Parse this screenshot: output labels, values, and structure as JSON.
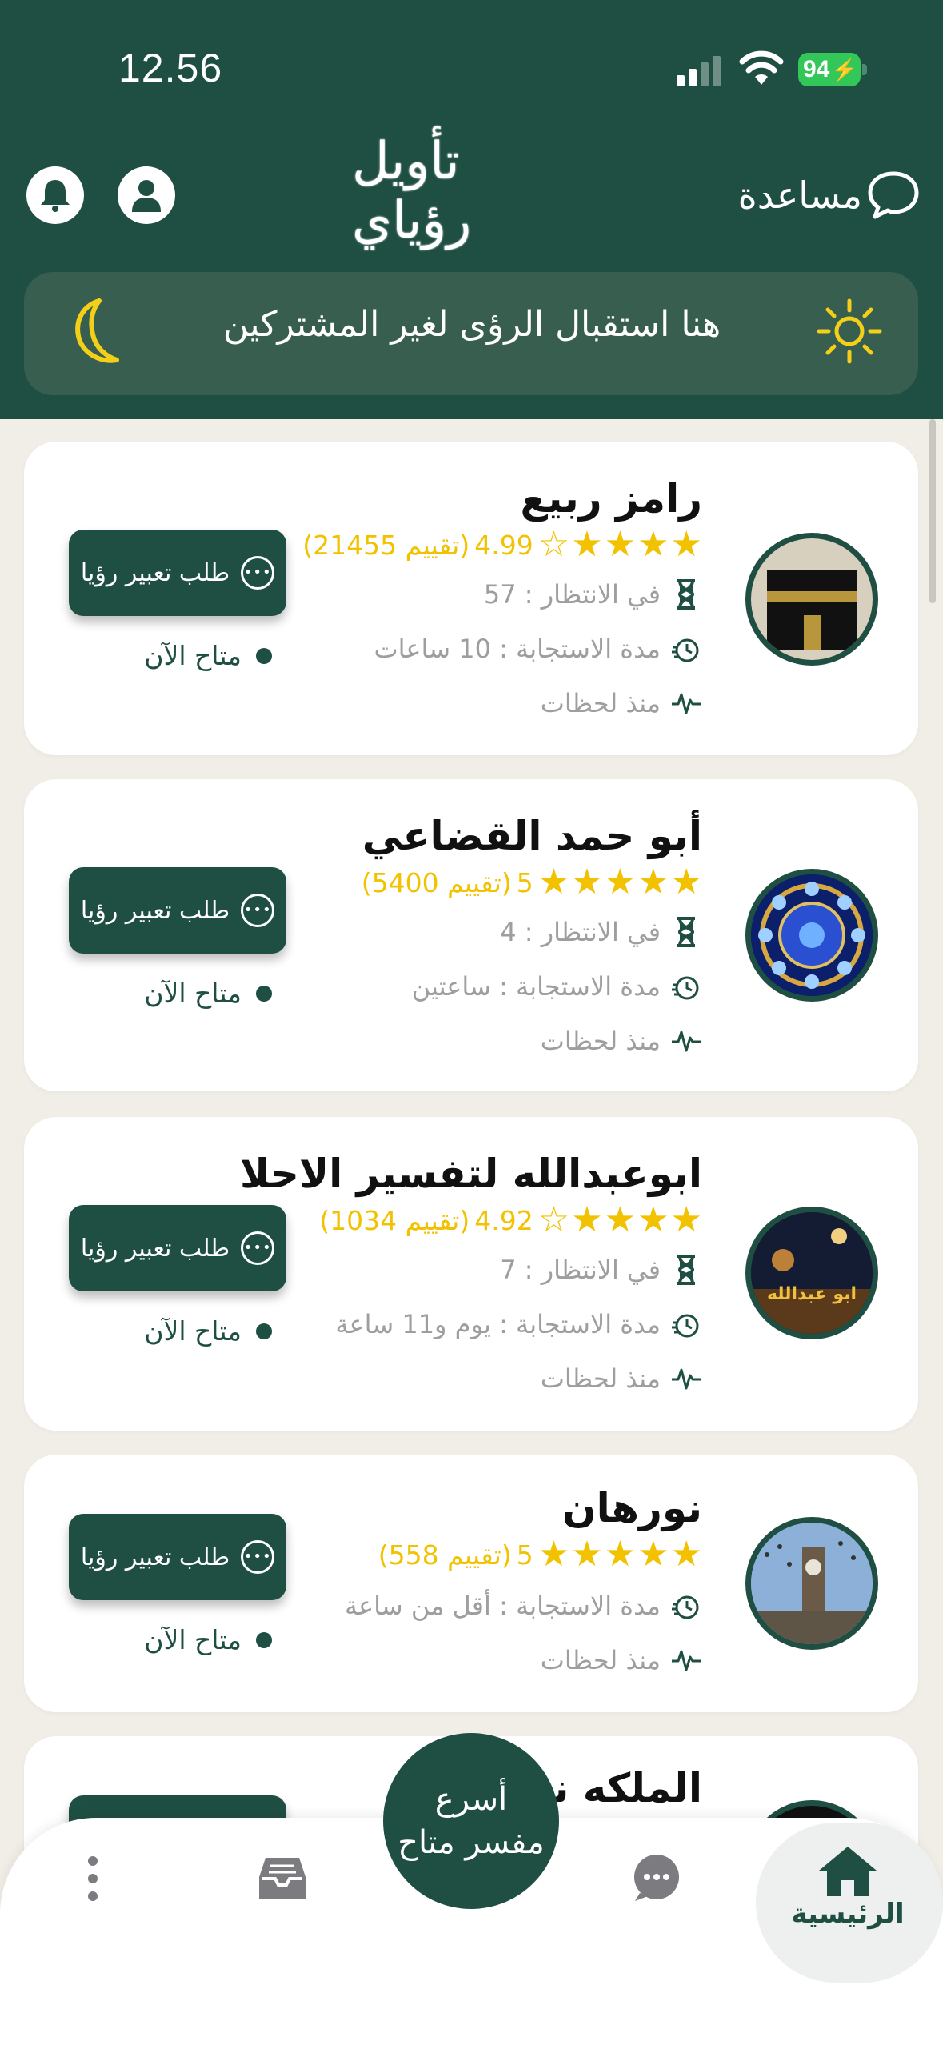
{
  "status": {
    "time": "12.56",
    "battery": "94"
  },
  "header": {
    "logo_text": "تأويل رؤياي",
    "help_label": "مساعدة",
    "banner_text": "هنا استقبال الرؤى لغير المشتركين"
  },
  "cards": [
    {
      "name": "رامز ربيع",
      "rating_value": "4.99",
      "rating_count": "(21455 تقييم)",
      "waiting": "في الانتظار : 57",
      "response": "مدة الاستجابة : 10 ساعات",
      "last_seen": "منذ لحظات",
      "request_label": "طلب تعبير رؤيا",
      "status": "متاح الآن",
      "stars_full": 4,
      "stars_empty": 1
    },
    {
      "name": "أبو حمد القضاعي",
      "rating_value": "5",
      "rating_count": "(5400 تقييم)",
      "waiting": "في الانتظار : 4",
      "response": "مدة الاستجابة : ساعتين",
      "last_seen": "منذ لحظات",
      "request_label": "طلب تعبير رؤيا",
      "status": "متاح الآن",
      "stars_full": 5,
      "stars_empty": 0
    },
    {
      "name": "ابوعبدالله لتفسير الاحلا",
      "rating_value": "4.92",
      "rating_count": "(1034 تقييم)",
      "waiting": "في الانتظار : 7",
      "response": "مدة الاستجابة : يوم و11 ساعة",
      "last_seen": "منذ لحظات",
      "request_label": "طلب تعبير رؤيا",
      "status": "متاح الآن",
      "avatar_text": "ابو عبدالله",
      "stars_full": 4,
      "stars_empty": 1
    },
    {
      "name": "نورهان",
      "rating_value": "5",
      "rating_count": "(558 تقييم)",
      "response": "مدة الاستجابة : أقل من ساعة",
      "last_seen": "منذ لحظات",
      "request_label": "طلب تعبير رؤيا",
      "status": "متاح الآن",
      "stars_full": 5,
      "stars_empty": 0
    },
    {
      "name": "الملكه نور"
    }
  ],
  "tabbar": {
    "home_label": "الرئيسية",
    "fab_line1": "أسرع",
    "fab_line2": "مفسر متاح"
  },
  "colors": {
    "primary": "#1f4f43",
    "star": "#f2c200",
    "muted": "#9e9e9e"
  }
}
